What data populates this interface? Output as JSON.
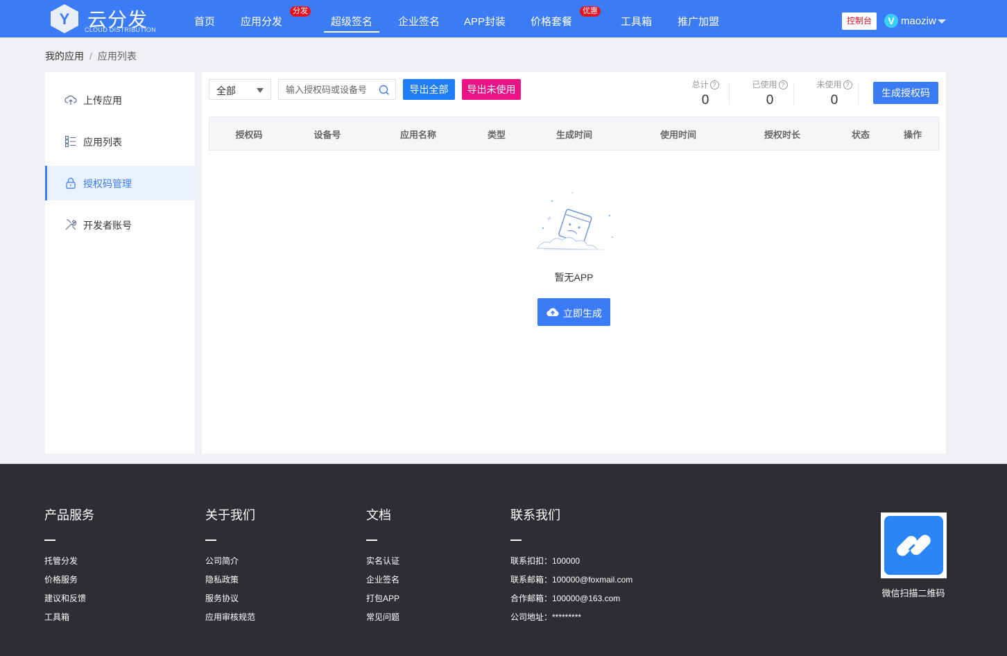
{
  "header": {
    "logo_title": "云分发",
    "logo_subtitle": "CLOUD DISTRIBUTION",
    "logo_letter": "Y",
    "nav": [
      {
        "label": "首页"
      },
      {
        "label": "应用分发",
        "badge": "分发"
      },
      {
        "label": "超级签名",
        "active": true
      },
      {
        "label": "企业签名"
      },
      {
        "label": "APP封装"
      },
      {
        "label": "价格套餐",
        "badge": "优惠"
      },
      {
        "label": "工具箱"
      },
      {
        "label": "推广加盟"
      }
    ],
    "console_label": "控制台",
    "user_initial": "V",
    "username": "maoziw",
    "accent_color": "#3b7cf6"
  },
  "breadcrumb": {
    "items": [
      "我的应用",
      "应用列表"
    ],
    "separator": "/"
  },
  "sidebar": {
    "items": [
      {
        "label": "上传应用",
        "icon": "cloud-upload-icon"
      },
      {
        "label": "应用列表",
        "icon": "list-icon"
      },
      {
        "label": "授权码管理",
        "icon": "lock-icon",
        "active": true
      },
      {
        "label": "开发者账号",
        "icon": "tools-icon"
      }
    ]
  },
  "toolbar": {
    "filter_value": "全部",
    "search_placeholder": "输入授权码或设备号",
    "export_all_label": "导出全部",
    "export_unused_label": "导出未使用",
    "generate_label": "生成授权码",
    "export_unused_color": "#ec1388"
  },
  "stats": [
    {
      "label": "总计",
      "value": "0"
    },
    {
      "label": "已使用",
      "value": "0"
    },
    {
      "label": "未使用",
      "value": "0"
    }
  ],
  "table": {
    "columns": [
      "授权码",
      "设备号",
      "应用名称",
      "类型",
      "生成时间",
      "使用时间",
      "授权时长",
      "状态",
      "操作"
    ],
    "rows": []
  },
  "empty_state": {
    "text": "暂无APP",
    "button_label": "立即生成"
  },
  "footer": {
    "columns": [
      {
        "title": "产品服务",
        "links": [
          "托管分发",
          "价格服务",
          "建议和反馈",
          "工具箱"
        ]
      },
      {
        "title": "关于我们",
        "links": [
          "公司简介",
          "隐私政策",
          "服务协议",
          "应用审核规范"
        ]
      },
      {
        "title": "文档",
        "links": [
          "实名认证",
          "企业签名",
          "打包APP",
          "常见问题"
        ]
      },
      {
        "title": "联系我们",
        "links": [
          "联系扣扣：100000",
          "联系邮箱：100000@foxmail.com",
          "合作邮箱：100000@163.com",
          "公司地址：*********"
        ]
      }
    ],
    "qr_caption": "微信扫描二维码"
  }
}
